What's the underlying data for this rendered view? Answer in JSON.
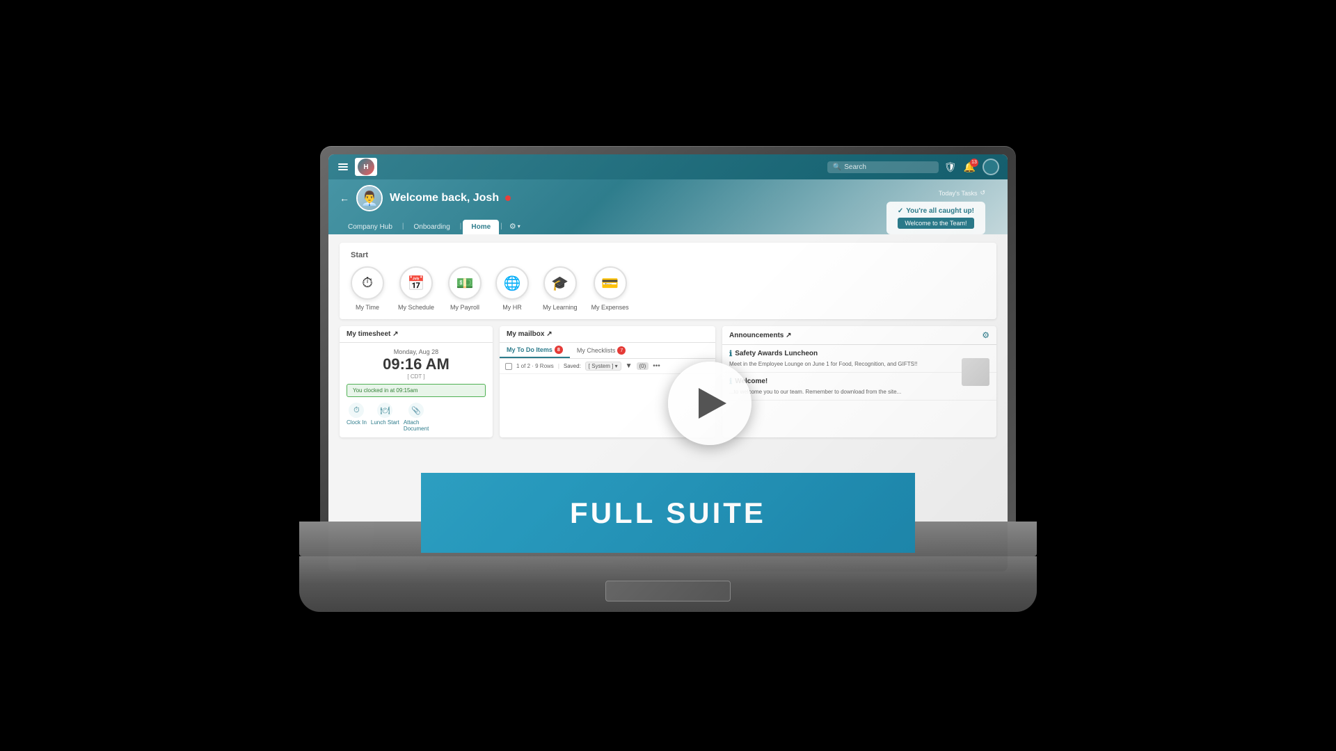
{
  "laptop": {
    "screen": {
      "top_nav": {
        "search_placeholder": "Search",
        "notification_badge": "13"
      },
      "sub_header": {
        "todays_tasks_label": "Today's Tasks",
        "welcome_text": "Welcome back, Josh",
        "task_status": "You're all caught up!",
        "welcome_btn": "Welcome to the Team!"
      },
      "nav_tabs": [
        {
          "label": "Company Hub",
          "active": false
        },
        {
          "label": "Onboarding",
          "active": false
        },
        {
          "label": "Home",
          "active": true
        },
        {
          "label": "⚙",
          "active": false
        }
      ],
      "start_section": {
        "label": "Start",
        "quick_links": [
          {
            "label": "My Time",
            "icon": "⏱"
          },
          {
            "label": "My Schedule",
            "icon": "📅"
          },
          {
            "label": "My Payroll",
            "icon": "💵"
          },
          {
            "label": "My HR",
            "icon": "🌐"
          },
          {
            "label": "My Learning",
            "icon": "🎓"
          },
          {
            "label": "My Expenses",
            "icon": "💳"
          }
        ]
      },
      "timesheet": {
        "title": "My timesheet ↗",
        "date": "Monday, Aug 28",
        "time": "09:16 AM",
        "timezone": "[ CDT ]",
        "clocked_in_msg": "You clocked in at 09:15am",
        "actions": [
          {
            "label": "Clock In",
            "icon": "⏱"
          },
          {
            "label": "Lunch Start",
            "icon": "🍽"
          },
          {
            "label": "Attach Document",
            "icon": "📎"
          }
        ]
      },
      "mailbox": {
        "title": "My mailbox ↗",
        "tabs": [
          {
            "label": "My To Do Items",
            "badge": "8",
            "active": true
          },
          {
            "label": "My Checklists",
            "badge": "7",
            "active": false
          }
        ],
        "pagination": "1 of 2 · 9 Rows",
        "saved_label": "Saved:",
        "saved_value": "[ System ]"
      },
      "announcements": {
        "title": "Announcements ↗",
        "items": [
          {
            "title": "Safety Awards Luncheon",
            "text": "Meet in the Employee Lounge on June 1 for Food, Recognition, and GIFTS!!"
          },
          {
            "title": "Welcome!",
            "text": "...to welcome you to our team. Remember to download from the site..."
          }
        ]
      }
    }
  },
  "overlay": {
    "full_suite_text": "FULL SUITE"
  }
}
